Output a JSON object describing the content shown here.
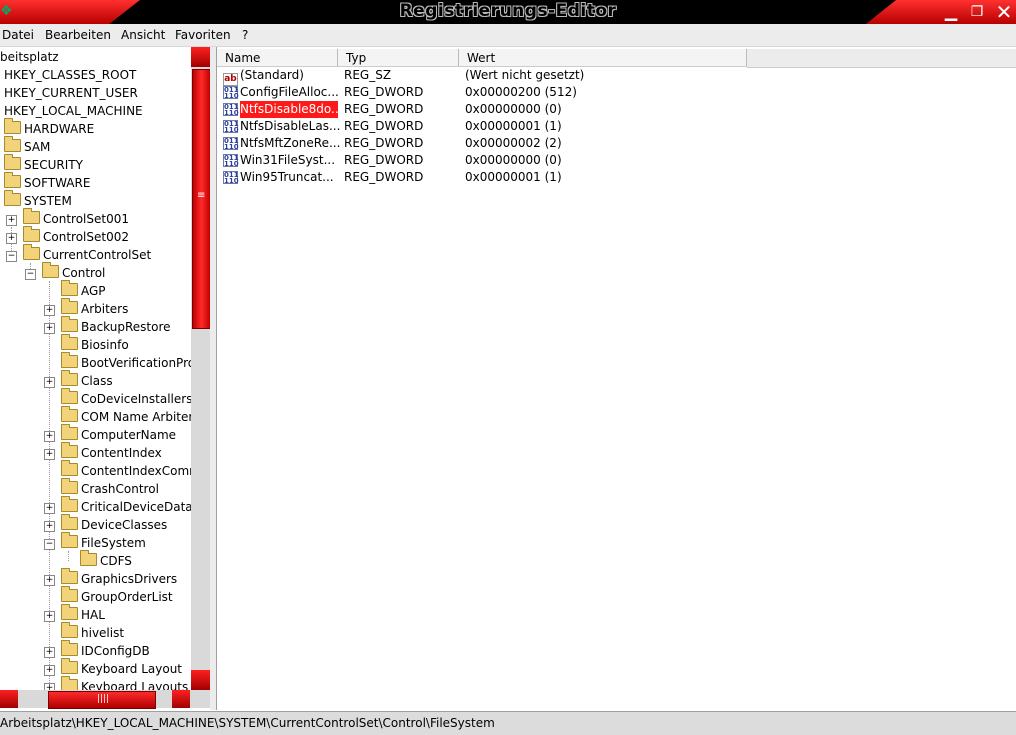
{
  "window": {
    "title": "Registrierungs-Editor"
  },
  "menu": [
    "Datei",
    "Bearbeiten",
    "Ansicht",
    "Favoriten",
    "?"
  ],
  "tree": {
    "root": "beitsplatz",
    "hives": [
      "HKEY_CLASSES_ROOT",
      "HKEY_CURRENT_USER",
      "HKEY_LOCAL_MACHINE"
    ],
    "hklm_children": [
      "HARDWARE",
      "SAM",
      "SECURITY",
      "SOFTWARE",
      "SYSTEM"
    ],
    "system_children": [
      "ControlSet001",
      "ControlSet002",
      "CurrentControlSet"
    ],
    "ccs_children": [
      "Control"
    ],
    "control_children": [
      "AGP",
      "Arbiters",
      "BackupRestore",
      "Biosinfo",
      "BootVerificationProg",
      "Class",
      "CoDeviceInstallers",
      "COM Name Arbiter",
      "ComputerName",
      "ContentIndex",
      "ContentIndexComm",
      "CrashControl",
      "CriticalDeviceDatab",
      "DeviceClasses",
      "FileSystem",
      "GraphicsDrivers",
      "GroupOrderList",
      "HAL",
      "hivelist",
      "IDConfigDB",
      "Keyboard Layout",
      "Keyboard Layouts"
    ],
    "filesystem_children": [
      "CDFS"
    ]
  },
  "list": {
    "columns": [
      "Name",
      "Typ",
      "Wert"
    ],
    "rows": [
      {
        "icon": "string-value-icon",
        "name": "(Standard)",
        "type": "REG_SZ",
        "value": "(Wert nicht gesetzt)"
      },
      {
        "icon": "dword-value-icon",
        "name": "ConfigFileAlloc...",
        "type": "REG_DWORD",
        "value": "0x00000200 (512)"
      },
      {
        "icon": "dword-value-icon",
        "name": "NtfsDisable8do...",
        "type": "REG_DWORD",
        "value": "0x00000000 (0)",
        "selected": true
      },
      {
        "icon": "dword-value-icon",
        "name": "NtfsDisableLas...",
        "type": "REG_DWORD",
        "value": "0x00000001 (1)"
      },
      {
        "icon": "dword-value-icon",
        "name": "NtfsMftZoneRe...",
        "type": "REG_DWORD",
        "value": "0x00000002 (2)"
      },
      {
        "icon": "dword-value-icon",
        "name": "Win31FileSyst...",
        "type": "REG_DWORD",
        "value": "0x00000000 (0)"
      },
      {
        "icon": "dword-value-icon",
        "name": "Win95Truncat...",
        "type": "REG_DWORD",
        "value": "0x00000001 (1)"
      }
    ]
  },
  "status": {
    "path": "Arbeitsplatz\\HKEY_LOCAL_MACHINE\\SYSTEM\\CurrentControlSet\\Control\\FileSystem"
  },
  "theme": {
    "accent": "#ff1a1a",
    "titlebar": "#000000"
  }
}
